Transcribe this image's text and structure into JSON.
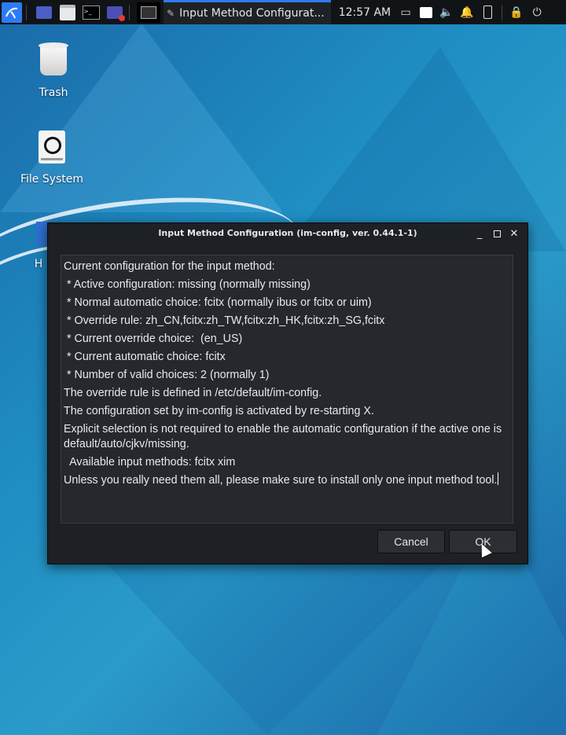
{
  "taskbar": {
    "window_title": "Input Method Configurat...",
    "clock": "12:57 AM"
  },
  "desktop": {
    "icons": [
      {
        "label": "Trash",
        "icon": "trash-icon"
      },
      {
        "label": "File System",
        "icon": "drive-icon"
      },
      {
        "label": "H",
        "icon": "home-folder-icon"
      }
    ]
  },
  "dialog": {
    "title": "Input Method Configuration (im-config, ver. 0.44.1-1)",
    "lines": [
      "Current configuration for the input method:",
      " * Active configuration: missing (normally missing)",
      " * Normal automatic choice: fcitx (normally ibus or fcitx or uim)",
      " * Override rule: zh_CN,fcitx:zh_TW,fcitx:zh_HK,fcitx:zh_SG,fcitx",
      " * Current override choice:  (en_US)",
      " * Current automatic choice: fcitx",
      " * Number of valid choices: 2 (normally 1)",
      "The override rule is defined in /etc/default/im-config.",
      "The configuration set by im-config is activated by re-starting X.",
      "Explicit selection is not required to enable the automatic configuration if the active one is default/auto/cjkv/missing.",
      "  Available input methods: fcitx xim",
      "Unless you really need them all, please make sure to install only one input method tool."
    ],
    "cancel_label": "Cancel",
    "ok_label": "OK"
  }
}
